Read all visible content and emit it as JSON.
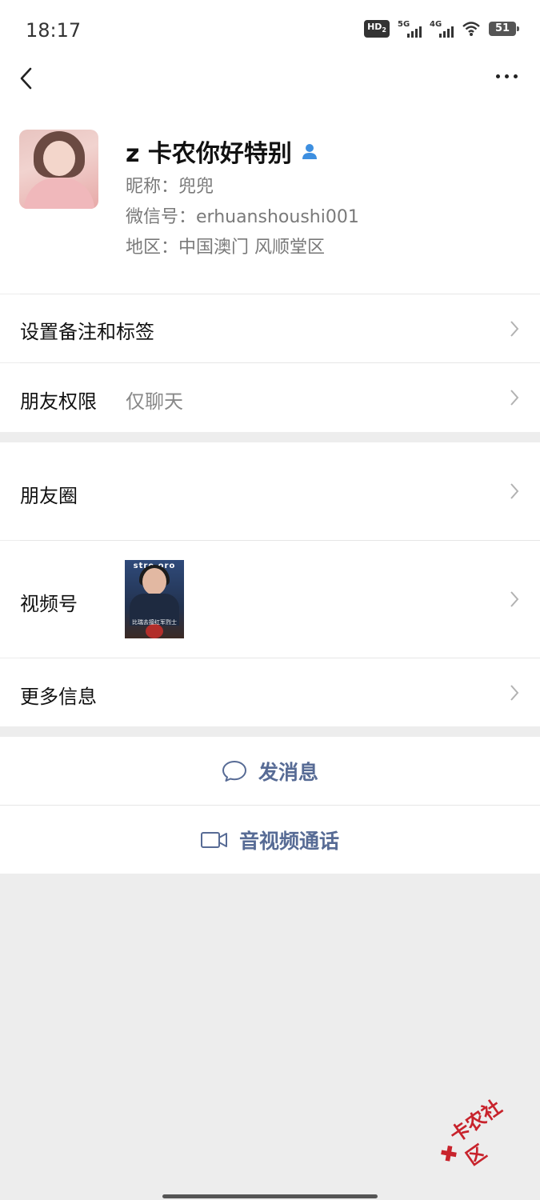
{
  "status_bar": {
    "time": "18:17",
    "hd_label": "HD",
    "hd_sub": "2",
    "sim1_label": "5G",
    "sim2_label": "4G",
    "battery": "51"
  },
  "profile": {
    "name": "z 卡农你好特别",
    "nickname": "昵称：兜兜",
    "wechat_id": "微信号：erhuanshoushi001",
    "region": "地区：中国澳门  风顺堂区"
  },
  "rows": {
    "remark_label": "设置备注和标签",
    "permission_label": "朋友权限",
    "permission_value": "仅聊天",
    "moments_label": "朋友圈",
    "channels_label": "视频号",
    "channels_thumb_top": "stro  oro",
    "channels_thumb_caption": "比瑞去接红军烈士",
    "more_info_label": "更多信息"
  },
  "actions": {
    "message_label": "发消息",
    "call_label": "音视频通话"
  },
  "watermark": {
    "text": "卡农社区"
  },
  "colors": {
    "link_blue": "#576b95",
    "verify_blue": "#3d8fe0",
    "watermark_red": "#c8232c"
  }
}
